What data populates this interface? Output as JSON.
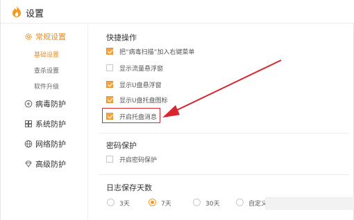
{
  "window": {
    "title": "设置"
  },
  "sidebar": {
    "groups": [
      {
        "label": "常规设置",
        "icon": "gear-icon",
        "active": true,
        "items": [
          {
            "label": "基础设置",
            "active": true
          },
          {
            "label": "查杀设置",
            "active": false
          },
          {
            "label": "软件升级",
            "active": false
          }
        ]
      },
      {
        "label": "病毒防护",
        "icon": "plus-circle-icon",
        "active": false
      },
      {
        "label": "系统防护",
        "icon": "system-icon",
        "active": false
      },
      {
        "label": "网络防护",
        "icon": "globe-icon",
        "active": false
      },
      {
        "label": "高级防护",
        "icon": "diamond-icon",
        "active": false
      }
    ]
  },
  "main": {
    "shortcuts": {
      "title": "快捷操作",
      "options": [
        {
          "label": "把“病毒扫描”加入右键菜单",
          "checked": true
        },
        {
          "label": "显示流量悬浮窗",
          "checked": false
        },
        {
          "label": "显示U盘悬浮窗",
          "checked": true
        },
        {
          "label": "显示U盘托盘图标",
          "checked": true
        },
        {
          "label": "开启托盘消息",
          "checked": true
        }
      ]
    },
    "password": {
      "title": "密码保护",
      "options": [
        {
          "label": "开启密码保护",
          "checked": false
        }
      ]
    },
    "log": {
      "title": "日志保存天数",
      "options": [
        {
          "label": "3天",
          "checked": false
        },
        {
          "label": "7天",
          "checked": true
        },
        {
          "label": "30天",
          "checked": false
        },
        {
          "label": "自定义",
          "checked": false
        }
      ],
      "custom_value": ""
    }
  },
  "colors": {
    "accent": "#e78d22",
    "highlight": "#d9262e"
  }
}
